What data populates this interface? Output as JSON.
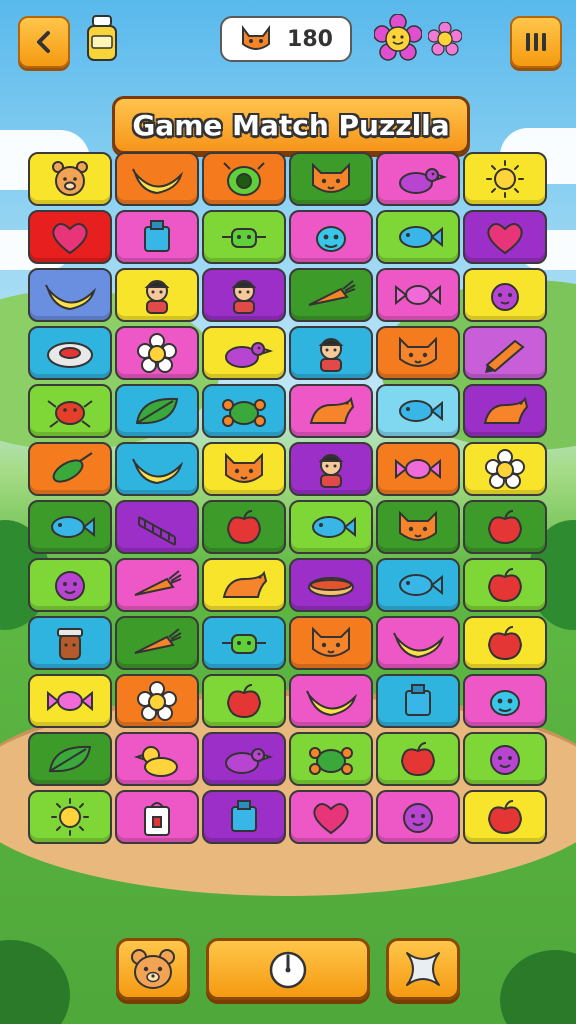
{
  "header": {
    "back_icon": "chevron-left-icon",
    "bottle_icon": "bottle-icon",
    "score_icon": "cat-face-icon",
    "score": "180",
    "flower_icons": [
      "flower-icon",
      "flower-icon"
    ],
    "pause_icon": "pause-icon"
  },
  "title": "Game Match Puzzlla",
  "grid": {
    "rows": [
      [
        {
          "icon": "bear",
          "bg": "#f8e52b"
        },
        {
          "icon": "banana",
          "bg": "#f57b1f"
        },
        {
          "icon": "bug",
          "bg": "#f47a1d"
        },
        {
          "icon": "cat",
          "bg": "#3d9b2a"
        },
        {
          "icon": "bird",
          "bg": "#ee58c6"
        },
        {
          "icon": "sun",
          "bg": "#f8e52b"
        }
      ],
      [
        {
          "icon": "heart",
          "bg": "#e81f1f"
        },
        {
          "icon": "box",
          "bg": "#ee58c6"
        },
        {
          "icon": "robot",
          "bg": "#7fd637"
        },
        {
          "icon": "alien",
          "bg": "#ee58c6"
        },
        {
          "icon": "fish",
          "bg": "#7fd637"
        },
        {
          "icon": "heart",
          "bg": "#9b2fc7"
        }
      ],
      [
        {
          "icon": "banana",
          "bg": "#6b8fe0"
        },
        {
          "icon": "person",
          "bg": "#f8e52b"
        },
        {
          "icon": "person",
          "bg": "#9b2fc7"
        },
        {
          "icon": "carrot",
          "bg": "#3d9b2a"
        },
        {
          "icon": "candy",
          "bg": "#ee58c6"
        },
        {
          "icon": "blob",
          "bg": "#f8e52b"
        }
      ],
      [
        {
          "icon": "ring",
          "bg": "#2fb4e0"
        },
        {
          "icon": "flower",
          "bg": "#ee58c6"
        },
        {
          "icon": "bird",
          "bg": "#f8e52b"
        },
        {
          "icon": "person",
          "bg": "#2fb4e0"
        },
        {
          "icon": "cat",
          "bg": "#f57b1f"
        },
        {
          "icon": "pencil",
          "bg": "#c85fd8"
        }
      ],
      [
        {
          "icon": "crab",
          "bg": "#7fd637"
        },
        {
          "icon": "leaf",
          "bg": "#2fb4e0"
        },
        {
          "icon": "turtle",
          "bg": "#2fb4e0"
        },
        {
          "icon": "dino",
          "bg": "#ee58c6"
        },
        {
          "icon": "fish",
          "bg": "#7fd8f0"
        },
        {
          "icon": "dino",
          "bg": "#9b2fc7"
        }
      ],
      [
        {
          "icon": "corn",
          "bg": "#f57b1f"
        },
        {
          "icon": "banana",
          "bg": "#2fb4e0"
        },
        {
          "icon": "cat",
          "bg": "#f8e52b"
        },
        {
          "icon": "person",
          "bg": "#9b2fc7"
        },
        {
          "icon": "candy",
          "bg": "#f57b1f"
        },
        {
          "icon": "flower",
          "bg": "#f8e52b"
        }
      ],
      [
        {
          "icon": "fish",
          "bg": "#3d9b2a"
        },
        {
          "icon": "ladder",
          "bg": "#9b2fc7"
        },
        {
          "icon": "apple",
          "bg": "#3d9b2a"
        },
        {
          "icon": "fish",
          "bg": "#7fd637"
        },
        {
          "icon": "cat",
          "bg": "#3d9b2a"
        },
        {
          "icon": "apple",
          "bg": "#3d9b2a"
        }
      ],
      [
        {
          "icon": "face",
          "bg": "#7fd637"
        },
        {
          "icon": "carrot",
          "bg": "#ee58c6"
        },
        {
          "icon": "dino",
          "bg": "#f8e52b"
        },
        {
          "icon": "hotdog",
          "bg": "#9b2fc7"
        },
        {
          "icon": "fish",
          "bg": "#2fb4e0"
        },
        {
          "icon": "apple",
          "bg": "#7fd637"
        }
      ],
      [
        {
          "icon": "jar",
          "bg": "#2fb4e0"
        },
        {
          "icon": "carrot",
          "bg": "#3d9b2a"
        },
        {
          "icon": "robot",
          "bg": "#2fb4e0"
        },
        {
          "icon": "cat",
          "bg": "#f57b1f"
        },
        {
          "icon": "banana",
          "bg": "#ee58c6"
        },
        {
          "icon": "apple",
          "bg": "#f8e52b"
        }
      ],
      [
        {
          "icon": "candy",
          "bg": "#f8e52b"
        },
        {
          "icon": "flower",
          "bg": "#f57b1f"
        },
        {
          "icon": "apple",
          "bg": "#7fd637"
        },
        {
          "icon": "banana",
          "bg": "#ee58c6"
        },
        {
          "icon": "box",
          "bg": "#2fb4e0"
        },
        {
          "icon": "alien",
          "bg": "#ee58c6"
        }
      ],
      [
        {
          "icon": "leaf",
          "bg": "#3d9b2a"
        },
        {
          "icon": "duck",
          "bg": "#ee58c6"
        },
        {
          "icon": "bird",
          "bg": "#9b2fc7"
        },
        {
          "icon": "turtle",
          "bg": "#7fd637"
        },
        {
          "icon": "apple",
          "bg": "#7fd637"
        },
        {
          "icon": "face",
          "bg": "#7fd637"
        }
      ],
      [
        {
          "icon": "sun",
          "bg": "#7fd637"
        },
        {
          "icon": "bag",
          "bg": "#ee58c6"
        },
        {
          "icon": "box",
          "bg": "#9b2fc7"
        },
        {
          "icon": "heart",
          "bg": "#ee58c6"
        },
        {
          "icon": "face",
          "bg": "#ee58c6"
        },
        {
          "icon": "apple",
          "bg": "#f8e52b"
        }
      ]
    ]
  },
  "footer": {
    "left_icon": "bear-face-icon",
    "middle_icon": "timer-icon",
    "right_icon": "close-icon"
  }
}
